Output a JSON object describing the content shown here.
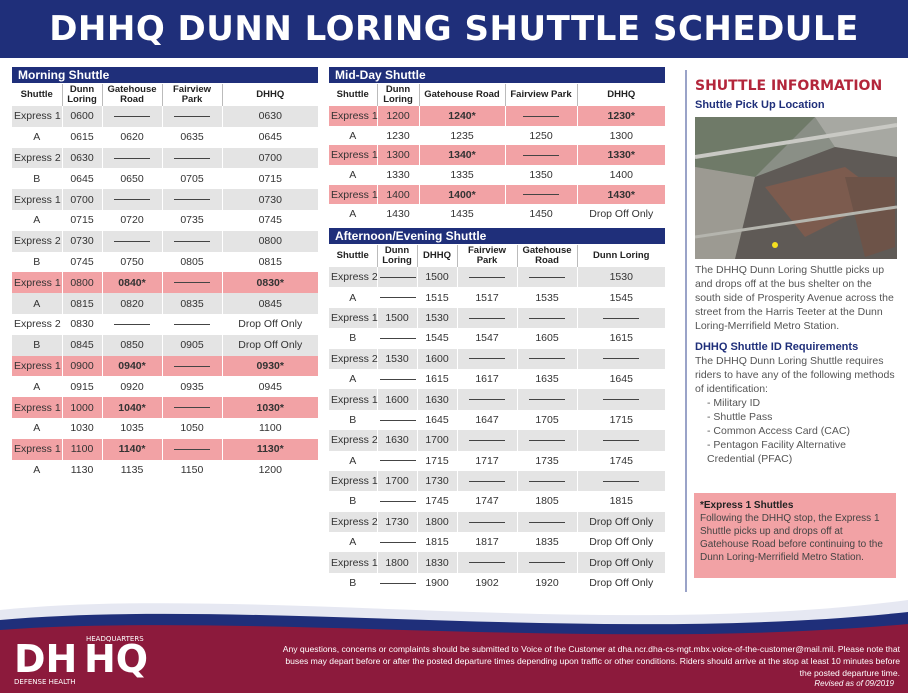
{
  "title": "DHHQ DUNN LORING SHUTTLE SCHEDULE",
  "morning": {
    "header": "Morning Shuttle",
    "columns": [
      "Shuttle",
      "Dunn Loring",
      "Gatehouse Road",
      "Fairview Park",
      "DHHQ"
    ],
    "rows": [
      {
        "style": "grey",
        "cells": [
          "Express 1",
          "0600",
          "—",
          "—",
          "0630"
        ]
      },
      {
        "style": "white",
        "cells": [
          "A",
          "0615",
          "0620",
          "0635",
          "0645"
        ]
      },
      {
        "style": "grey",
        "cells": [
          "Express 2",
          "0630",
          "—",
          "—",
          "0700"
        ]
      },
      {
        "style": "white",
        "cells": [
          "B",
          "0645",
          "0650",
          "0705",
          "0715"
        ]
      },
      {
        "style": "grey",
        "cells": [
          "Express 1",
          "0700",
          "—",
          "—",
          "0730"
        ]
      },
      {
        "style": "white",
        "cells": [
          "A",
          "0715",
          "0720",
          "0735",
          "0745"
        ]
      },
      {
        "style": "grey",
        "cells": [
          "Express 2",
          "0730",
          "—",
          "—",
          "0800"
        ]
      },
      {
        "style": "white",
        "cells": [
          "B",
          "0745",
          "0750",
          "0805",
          "0815"
        ]
      },
      {
        "style": "red",
        "cells": [
          "Express 1",
          "0800",
          "0840*",
          "—",
          "0830*"
        ]
      },
      {
        "style": "grey",
        "cells": [
          "A",
          "0815",
          "0820",
          "0835",
          "0845"
        ]
      },
      {
        "style": "white",
        "cells": [
          "Express 2",
          "0830",
          "—",
          "—",
          "Drop Off Only"
        ]
      },
      {
        "style": "grey",
        "cells": [
          "B",
          "0845",
          "0850",
          "0905",
          "Drop Off Only"
        ]
      },
      {
        "style": "red",
        "cells": [
          "Express 1",
          "0900",
          "0940*",
          "—",
          "0930*"
        ]
      },
      {
        "style": "white",
        "cells": [
          "A",
          "0915",
          "0920",
          "0935",
          "0945"
        ]
      },
      {
        "style": "red",
        "cells": [
          "Express 1",
          "1000",
          "1040*",
          "—",
          "1030*"
        ]
      },
      {
        "style": "white",
        "cells": [
          "A",
          "1030",
          "1035",
          "1050",
          "1100"
        ]
      },
      {
        "style": "red",
        "cells": [
          "Express 1",
          "1100",
          "1140*",
          "—",
          "1130*"
        ]
      },
      {
        "style": "white",
        "cells": [
          "A",
          "1130",
          "1135",
          "1150",
          "1200"
        ]
      }
    ]
  },
  "midday": {
    "header": "Mid-Day Shuttle",
    "columns": [
      "Shuttle",
      "Dunn Loring",
      "Gatehouse Road",
      "Fairview Park",
      "DHHQ"
    ],
    "rows": [
      {
        "style": "red",
        "cells": [
          "Express 1",
          "1200",
          "1240*",
          "—",
          "1230*"
        ]
      },
      {
        "style": "white",
        "cells": [
          "A",
          "1230",
          "1235",
          "1250",
          "1300"
        ]
      },
      {
        "style": "red",
        "cells": [
          "Express 1",
          "1300",
          "1340*",
          "—",
          "1330*"
        ]
      },
      {
        "style": "white",
        "cells": [
          "A",
          "1330",
          "1335",
          "1350",
          "1400"
        ]
      },
      {
        "style": "red",
        "cells": [
          "Express 1",
          "1400",
          "1400*",
          "—",
          "1430*"
        ]
      },
      {
        "style": "white",
        "cells": [
          "A",
          "1430",
          "1435",
          "1450",
          "Drop Off Only"
        ]
      }
    ]
  },
  "afternoon": {
    "header": "Afternoon/Evening Shuttle",
    "columns": [
      "Shuttle",
      "Dunn Loring",
      "DHHQ",
      "Fairview Park",
      "Gatehouse Road",
      "Dunn Loring"
    ],
    "rows": [
      {
        "style": "grey",
        "cells": [
          "Express 2",
          "—",
          "1500",
          "—",
          "—",
          "1530"
        ]
      },
      {
        "style": "white",
        "cells": [
          "A",
          "—",
          "1515",
          "1517",
          "1535",
          "1545"
        ]
      },
      {
        "style": "grey",
        "cells": [
          "Express 1",
          "1500",
          "1530",
          "—",
          "—",
          "—"
        ]
      },
      {
        "style": "white",
        "cells": [
          "B",
          "—",
          "1545",
          "1547",
          "1605",
          "1615"
        ]
      },
      {
        "style": "grey",
        "cells": [
          "Express 2",
          "1530",
          "1600",
          "—",
          "—",
          "—"
        ]
      },
      {
        "style": "white",
        "cells": [
          "A",
          "—",
          "1615",
          "1617",
          "1635",
          "1645"
        ]
      },
      {
        "style": "grey",
        "cells": [
          "Express 1",
          "1600",
          "1630",
          "—",
          "—",
          "—"
        ]
      },
      {
        "style": "white",
        "cells": [
          "B",
          "—",
          "1645",
          "1647",
          "1705",
          "1715"
        ]
      },
      {
        "style": "grey",
        "cells": [
          "Express 2",
          "1630",
          "1700",
          "—",
          "—",
          "—"
        ]
      },
      {
        "style": "white",
        "cells": [
          "A",
          "—",
          "1715",
          "1717",
          "1735",
          "1745"
        ]
      },
      {
        "style": "grey",
        "cells": [
          "Express 1",
          "1700",
          "1730",
          "—",
          "—",
          "—"
        ]
      },
      {
        "style": "white",
        "cells": [
          "B",
          "—",
          "1745",
          "1747",
          "1805",
          "1815"
        ]
      },
      {
        "style": "grey",
        "cells": [
          "Express 2",
          "1730",
          "1800",
          "—",
          "—",
          "Drop Off Only"
        ]
      },
      {
        "style": "white",
        "cells": [
          "A",
          "—",
          "1815",
          "1817",
          "1835",
          "Drop Off Only"
        ]
      },
      {
        "style": "grey",
        "cells": [
          "Express 1",
          "1800",
          "1830",
          "—",
          "—",
          "Drop Off Only"
        ]
      },
      {
        "style": "white",
        "cells": [
          "B",
          "—",
          "1900",
          "1902",
          "1920",
          "Drop Off Only"
        ]
      }
    ]
  },
  "info": {
    "title": "SHUTTLE INFORMATION",
    "pickup_heading": "Shuttle Pick Up Location",
    "pickup_text": "The DHHQ Dunn Loring Shuttle picks up and drops off at the bus shelter on the south side of Prosperity Avenue across the street from the Harris Teeter at the Dunn Loring-Merrifield Metro Station.",
    "id_heading": "DHHQ Shuttle ID Requirements",
    "id_text": "The DHHQ Dunn Loring Shuttle requires riders to have any of the following methods of identification:",
    "id_items": [
      "- Military ID",
      "- Shuttle Pass",
      "- Common Access Card (CAC)",
      "- Pentagon Facility Alternative Credential (PFAC)"
    ],
    "express_heading": "*Express 1 Shuttles",
    "express_text": "Following the DHHQ stop, the Express 1 Shuttle picks up and drops off at Gatehouse Road before continuing to the Dunn Loring-Merrifield Metro Station."
  },
  "footer": {
    "logo_main": "DHHQ",
    "logo_top": "HEADQUARTERS",
    "logo_bottom": "DEFENSE HEALTH",
    "text": "Any questions, concerns or complaints should be submitted to Voice of the Customer at dha.ncr.dha-cs-mgt.mbx.voice-of-the-customer@mail.mil. Please note that buses may depart before or after the posted departure times depending upon traffic or other conditions. Riders should arrive at the stop at least 10 minutes before the posted departure time.",
    "revised": "Revised as of 09/2019"
  },
  "colors": {
    "navy": "#1f2f7a",
    "maroon": "#8c1a3c",
    "highlight": "#f2a2a5",
    "grey_row": "#e4e4e4",
    "info_red": "#b3263b"
  }
}
